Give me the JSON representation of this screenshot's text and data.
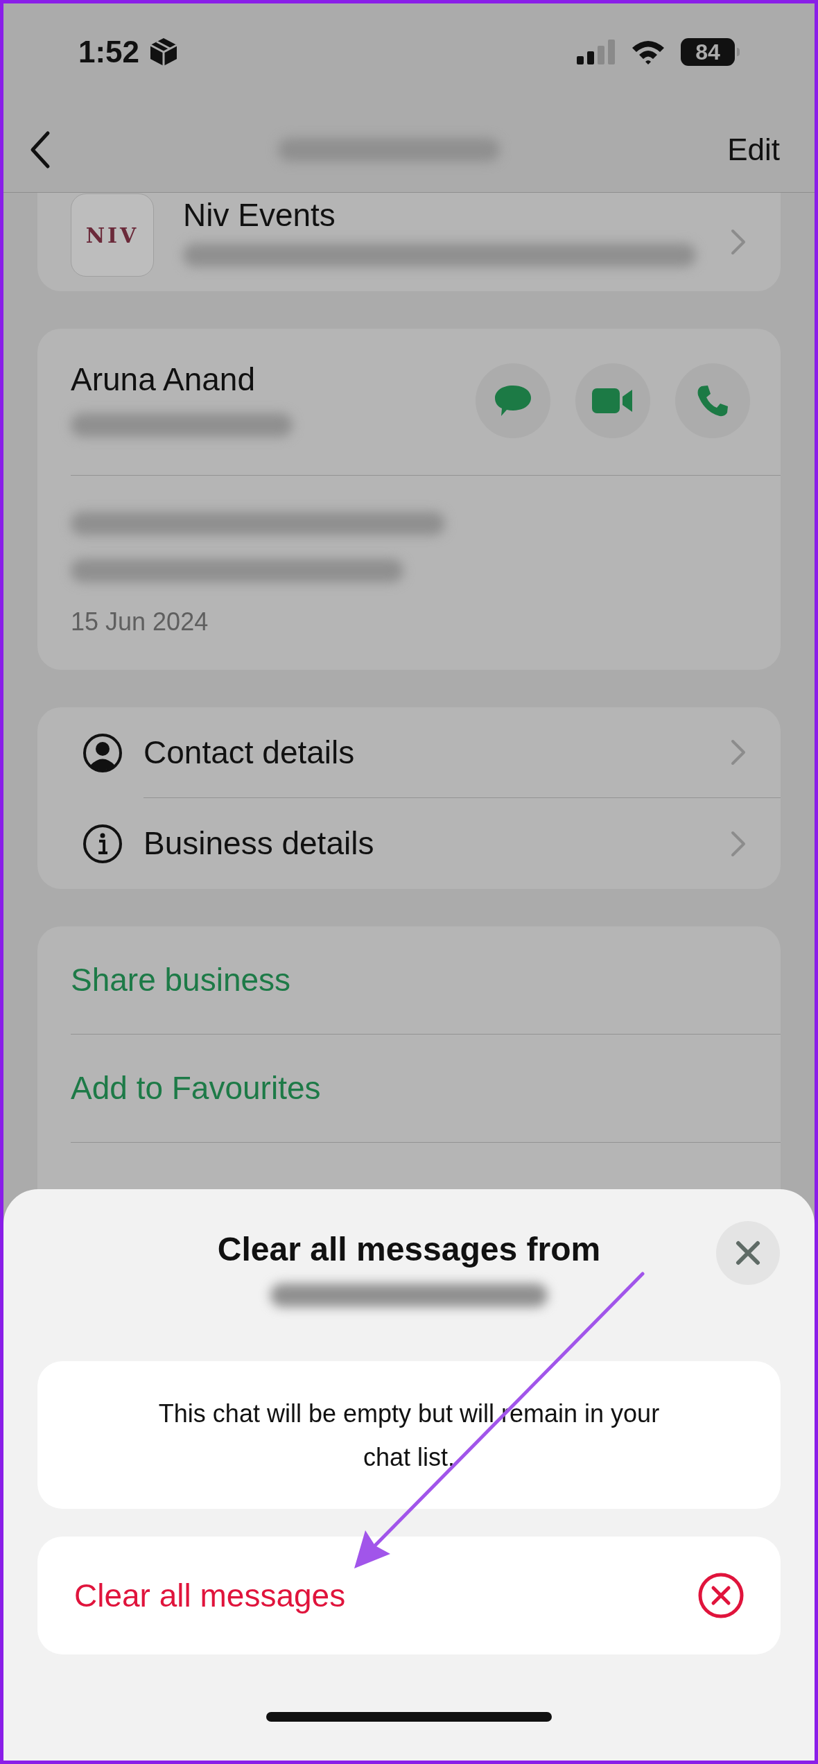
{
  "status_bar": {
    "time": "1:52",
    "battery": "84"
  },
  "nav": {
    "action": "Edit"
  },
  "business_card": {
    "logo_text": "NIV",
    "name": "Niv Events"
  },
  "contact_card": {
    "name": "Aruna Anand",
    "date": "15 Jun 2024"
  },
  "detail_items": [
    {
      "kind": "contact",
      "label": "Contact details"
    },
    {
      "kind": "business",
      "label": "Business details"
    }
  ],
  "actions": [
    {
      "label": "Share business"
    },
    {
      "label": "Add to Favourites"
    }
  ],
  "sheet": {
    "title": "Clear all messages from",
    "message": "This chat will be empty but will remain in your chat list.",
    "action": "Clear all messages"
  }
}
